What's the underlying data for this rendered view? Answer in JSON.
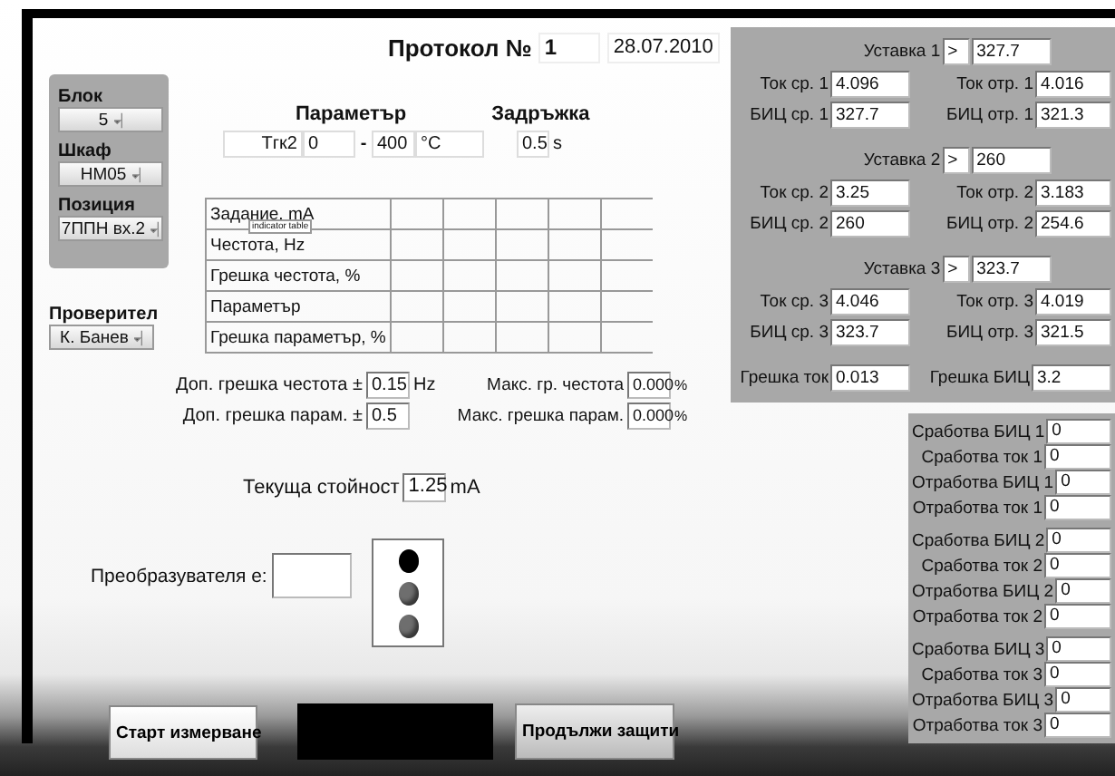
{
  "protocol": {
    "label": "Протокол №",
    "number": "1",
    "date": "28.07.2010"
  },
  "selectors": [
    {
      "label": "Блок",
      "value": "5"
    },
    {
      "label": "Шкаф",
      "value": "HM05"
    },
    {
      "label": "Позиция",
      "value": "7ППН вх.2"
    }
  ],
  "inspector": {
    "label": "Проверител",
    "value": "К. Банев"
  },
  "parameter": {
    "heading": "Параметър",
    "name": "Тгк2",
    "min": "0",
    "separator": "-",
    "max": "400",
    "unit": "°C"
  },
  "delay": {
    "heading": "Задръжка",
    "value": "0.5",
    "unit": "s"
  },
  "table": {
    "rows": [
      "Задание, mA",
      "Честота, Hz",
      "Грешка честота, %",
      "Параметър",
      "Грешка параметър, %"
    ],
    "tooltip": "indicator table"
  },
  "tolerances": [
    {
      "label": "Доп. грешка честота ±",
      "value": "0.15",
      "unit": "Hz"
    },
    {
      "label": "Доп. грешка парам. ±",
      "value": "0.5"
    }
  ],
  "max_errors": [
    {
      "label": "Макс. гр. честота",
      "value": "0.000",
      "unit": "%"
    },
    {
      "label": "Макс. грешка парам.",
      "value": "0.000",
      "unit": "%"
    }
  ],
  "current": {
    "label": "Текуща стойност",
    "value": "1.25",
    "unit": "mA"
  },
  "converter": {
    "label": "Преобразувателя е:"
  },
  "lamps": [
    {
      "color": "#000000"
    },
    {
      "color": "#6e6e6e"
    },
    {
      "color": "#6e6e6e"
    }
  ],
  "buttons": [
    {
      "label": "Старт измерване"
    },
    {
      "label": "Продължи защити"
    }
  ],
  "setpoints": [
    {
      "label": "Уставка 1",
      "operator": ">",
      "value": "327.7",
      "readings": [
        {
          "label": "Ток ср. 1",
          "value": "4.096"
        },
        {
          "label": "Ток отр. 1",
          "value": "4.016"
        },
        {
          "label": "БИЦ ср. 1",
          "value": "327.7"
        },
        {
          "label": "БИЦ отр. 1",
          "value": "321.3"
        }
      ]
    },
    {
      "label": "Уставка 2",
      "operator": ">",
      "value": "260",
      "readings": [
        {
          "label": "Ток ср. 2",
          "value": "3.25"
        },
        {
          "label": "Ток отр. 2",
          "value": "3.183"
        },
        {
          "label": "БИЦ ср. 2",
          "value": "260"
        },
        {
          "label": "БИЦ отр. 2",
          "value": "254.6"
        }
      ]
    },
    {
      "label": "Уставка 3",
      "operator": ">",
      "value": "323.7",
      "readings": [
        {
          "label": "Ток ср. 3",
          "value": "4.046"
        },
        {
          "label": "Ток отр. 3",
          "value": "4.019"
        },
        {
          "label": "БИЦ ср. 3",
          "value": "323.7"
        },
        {
          "label": "БИЦ отр. 3",
          "value": "321.5"
        }
      ]
    }
  ],
  "errors": [
    {
      "label": "Грешка ток",
      "value": "0.013"
    },
    {
      "label": "Грешка БИЦ",
      "value": "3.2"
    }
  ],
  "trips": [
    {
      "items": [
        {
          "label": "Сработва БИЦ 1",
          "value": "0"
        },
        {
          "label": "Сработва ток 1",
          "value": "0"
        },
        {
          "label": "Отработва БИЦ 1",
          "value": "0"
        },
        {
          "label": "Отработва ток 1",
          "value": "0"
        }
      ]
    },
    {
      "items": [
        {
          "label": "Сработва БИЦ 2",
          "value": "0"
        },
        {
          "label": "Сработва ток 2",
          "value": "0"
        },
        {
          "label": "Отработва БИЦ 2",
          "value": "0"
        },
        {
          "label": "Отработва ток 2",
          "value": "0"
        }
      ]
    },
    {
      "items": [
        {
          "label": "Сработва БИЦ 3",
          "value": "0"
        },
        {
          "label": "Сработва ток 3",
          "value": "0"
        },
        {
          "label": "Отработва БИЦ 3",
          "value": "0"
        },
        {
          "label": "Отработва ток 3",
          "value": "0"
        }
      ]
    }
  ]
}
